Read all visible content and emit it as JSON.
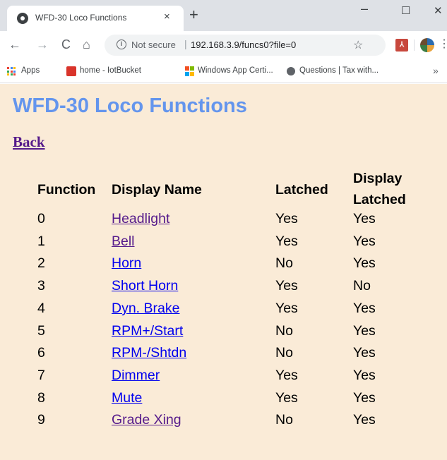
{
  "browser": {
    "tab_title": "WFD-30 Loco Functions",
    "tab_close": "×",
    "new_tab": "+",
    "window_minimize": "–",
    "window_maximize": "☐",
    "window_close": "✕",
    "nav": {
      "back": "←",
      "forward": "→",
      "reload": "C",
      "home": "⌂"
    },
    "security_label": "Not secure",
    "url": "192.168.3.9/funcs0?file=0",
    "bookmark_star": "☆",
    "menu": "⋮",
    "bookmarks": [
      {
        "label": "Apps",
        "icon": "apps-grid-icon"
      },
      {
        "label": "home - IotBucket",
        "icon": "iotbucket-icon"
      },
      {
        "label": "Windows App Certi...",
        "icon": "windows-logo-icon"
      },
      {
        "label": "Questions | Tax with...",
        "icon": "questions-icon"
      }
    ],
    "bookmarks_more": "»"
  },
  "page": {
    "title": "WFD-30 Loco Functions",
    "back_link": "Back",
    "colors": {
      "background": "#faebd7",
      "title": "#6495ed",
      "link_unvisited": "#0000ee",
      "link_visited": "#551a8b"
    },
    "table": {
      "headers": {
        "function": "Function",
        "display_name": "Display Name",
        "latched": "Latched",
        "display_latched_line1": "Display",
        "display_latched_line2": "Latched"
      },
      "rows": [
        {
          "function": "0",
          "name": "Headlight",
          "latched": "Yes",
          "display_latched": "Yes",
          "visited": true
        },
        {
          "function": "1",
          "name": "Bell",
          "latched": "Yes",
          "display_latched": "Yes",
          "visited": true
        },
        {
          "function": "2",
          "name": "Horn",
          "latched": "No",
          "display_latched": "Yes",
          "visited": false
        },
        {
          "function": "3",
          "name": "Short Horn",
          "latched": "Yes",
          "display_latched": "No",
          "visited": false
        },
        {
          "function": "4",
          "name": "Dyn. Brake",
          "latched": "Yes",
          "display_latched": "Yes",
          "visited": false
        },
        {
          "function": "5",
          "name": "RPM+/Start",
          "latched": "No",
          "display_latched": "Yes",
          "visited": false
        },
        {
          "function": "6",
          "name": "RPM-/Shtdn",
          "latched": "No",
          "display_latched": "Yes",
          "visited": false
        },
        {
          "function": "7",
          "name": "Dimmer",
          "latched": "Yes",
          "display_latched": "Yes",
          "visited": false
        },
        {
          "function": "8",
          "name": "Mute",
          "latched": "Yes",
          "display_latched": "Yes",
          "visited": false
        },
        {
          "function": "9",
          "name": "Grade Xing",
          "latched": "No",
          "display_latched": "Yes",
          "visited": true
        }
      ]
    }
  }
}
